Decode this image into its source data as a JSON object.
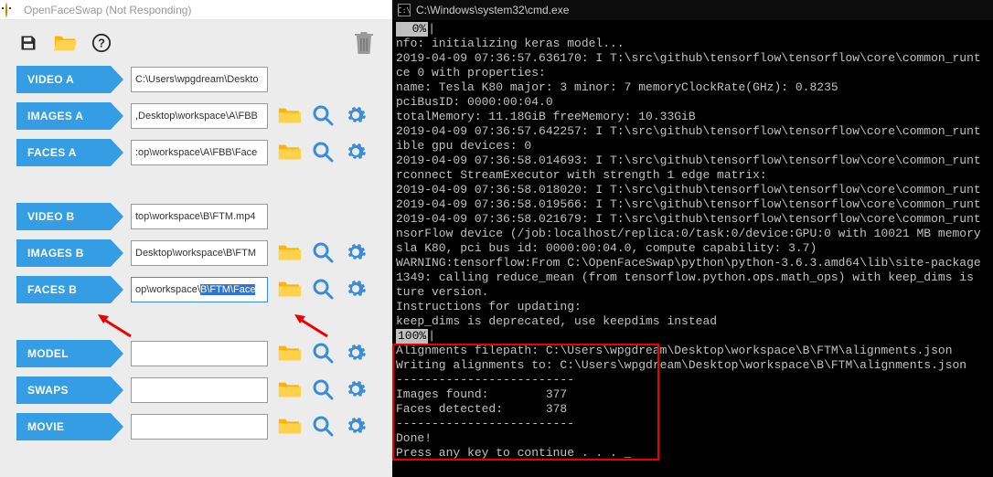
{
  "left": {
    "title": "OpenFaceSwap (Not Responding)",
    "labels": {
      "video_a": "VIDEO A",
      "images_a": "IMAGES A",
      "faces_a": "FACES A",
      "video_b": "VIDEO B",
      "images_b": "IMAGES B",
      "faces_b": "FACES B",
      "model": "MODEL",
      "swaps": "SWAPS",
      "movie": "MOVIE"
    },
    "values": {
      "video_a": "C:\\Users\\wpgdream\\Deskto",
      "images_a": ",Desktop\\workspace\\A\\FBB",
      "faces_a": ":op\\workspace\\A\\FBB\\Face",
      "video_b": "top\\workspace\\B\\FTM.mp4",
      "images_b": "Desktop\\workspace\\B\\FTM",
      "faces_b_pre": "op\\workspace\\",
      "faces_b_sel": "B\\FTM\\Face",
      "model": "",
      "swaps": "",
      "movie": ""
    }
  },
  "right": {
    "title": "C:\\Windows\\system32\\cmd.exe",
    "lines": [
      "  0%|",
      "nfo: initializing keras model...",
      "2019-04-09 07:36:57.636170: I T:\\src\\github\\tensorflow\\tensorflow\\core\\common_runt",
      "ce 0 with properties:",
      "name: Tesla K80 major: 3 minor: 7 memoryClockRate(GHz): 0.8235",
      "pciBusID: 0000:00:04.0",
      "totalMemory: 11.18GiB freeMemory: 10.33GiB",
      "2019-04-09 07:36:57.642257: I T:\\src\\github\\tensorflow\\tensorflow\\core\\common_runt",
      "ible gpu devices: 0",
      "2019-04-09 07:36:58.014693: I T:\\src\\github\\tensorflow\\tensorflow\\core\\common_runt",
      "rconnect StreamExecutor with strength 1 edge matrix:",
      "2019-04-09 07:36:58.018020: I T:\\src\\github\\tensorflow\\tensorflow\\core\\common_runt",
      "2019-04-09 07:36:58.019566: I T:\\src\\github\\tensorflow\\tensorflow\\core\\common_runt",
      "2019-04-09 07:36:58.021679: I T:\\src\\github\\tensorflow\\tensorflow\\core\\common_runt",
      "nsorFlow device (/job:localhost/replica:0/task:0/device:GPU:0 with 10021 MB memory",
      "sla K80, pci bus id: 0000:00:04.0, compute capability: 3.7)",
      "WARNING:tensorflow:From C:\\OpenFaceSwap\\python\\python-3.6.3.amd64\\lib\\site-package",
      "1349: calling reduce_mean (from tensorflow.python.ops.math_ops) with keep_dims is ",
      "ture version.",
      "Instructions for updating:",
      "keep_dims is deprecated, use keepdims instead",
      "100%|",
      "Alignments filepath: C:\\Users\\wpgdream\\Desktop\\workspace\\B\\FTM\\alignments.json",
      "Writing alignments to: C:\\Users\\wpgdream\\Desktop\\workspace\\B\\FTM\\alignments.json",
      "-------------------------",
      "Images found:        377",
      "Faces detected:      378",
      "-------------------------",
      "Done!",
      "Press any key to continue . . . _"
    ]
  }
}
